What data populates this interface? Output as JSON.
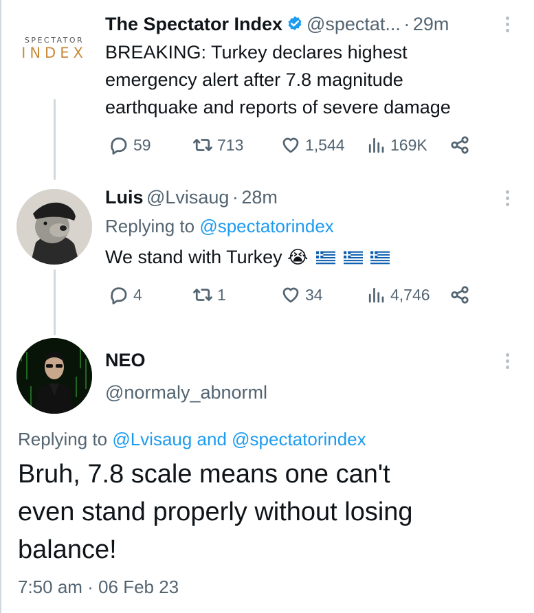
{
  "tweet1": {
    "logo_top": "SPECTATOR",
    "logo_bottom": "INDEX",
    "name": "The Spectator Index",
    "handle": "@spectat...",
    "sep": "·",
    "time": "29m",
    "text_lines": [
      "BREAKING: Turkey declares highest",
      "emergency alert after 7.8 magnitude",
      "earthquake and reports of severe damage"
    ],
    "replies": "59",
    "retweets": "713",
    "likes": "1,544",
    "views": "169K"
  },
  "tweet2": {
    "name": "Luis",
    "handle": "@Lvisaug",
    "sep": "·",
    "time": "28m",
    "replying_prefix": "Replying to ",
    "replying_handle": "@spectatorindex",
    "text": "We stand with Turkey ",
    "emoji": "😭",
    "replies": "4",
    "retweets": "1",
    "likes": "34",
    "views": "4,746"
  },
  "tweet3": {
    "name": "NEO",
    "handle": "@normaly_abnorml",
    "replying_prefix": "Replying to ",
    "replying_handles": "@Lvisaug and @spectatorindex",
    "text_lines": [
      "Bruh, 7.8 scale means one can't",
      "even stand properly without losing",
      "balance!"
    ],
    "timestamp": "7:50 am · 06 Feb 23"
  },
  "colors": {
    "accent": "#1d9bf0",
    "muted": "#536471",
    "text": "#0f1419",
    "logo": "#c98a3a"
  },
  "icons": [
    "reply-icon",
    "retweet-icon",
    "like-icon",
    "views-icon",
    "share-icon",
    "more-icon",
    "verified-icon"
  ]
}
